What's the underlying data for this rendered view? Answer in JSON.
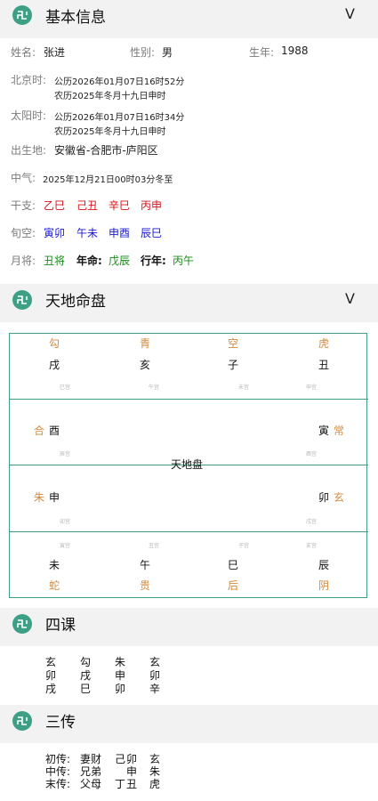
{
  "basic": {
    "title": "基本信息",
    "chevron": "V",
    "name_label": "姓名:",
    "name": "张进",
    "gender_label": "性别:",
    "gender": "男",
    "year_label": "生年:",
    "year": "1988",
    "beijing_label": "北京时:",
    "beijing_line1": "公历2026年01月07日16时52分",
    "beijing_line2": "农历2025年冬月十九日申时",
    "solar_label": "太阳时:",
    "solar_line1": "公历2026年01月07日16时34分",
    "solar_line2": "农历2025年冬月十九日申时",
    "birthplace_label": "出生地:",
    "birthplace": "安徽省-合肥市-庐阳区",
    "zhongqi_label": "中气:",
    "zhongqi": "2025年12月21日00时03分冬至",
    "ganzhi_label": "干支:",
    "ganzhi": [
      "乙巳",
      "己丑",
      "辛巳",
      "丙申"
    ],
    "xunkong_label": "旬空:",
    "xunkong": [
      "寅卯",
      "午未",
      "申酉",
      "辰巳"
    ],
    "yuejiang_label": "月将:",
    "yuejiang": "丑将",
    "nianming_label": "年命:",
    "nianming": "戊辰",
    "xingnian_label": "行年:",
    "xingnian": "丙午"
  },
  "tiandi": {
    "title": "天地命盘",
    "chevron": "V",
    "center_label": "天地盘",
    "top": {
      "generals": [
        "勾",
        "青",
        "空",
        "虎"
      ],
      "branches": [
        "戌",
        "亥",
        "子",
        "丑"
      ],
      "gongs": [
        "巳宫",
        "午宫",
        "未宫",
        "申宫"
      ]
    },
    "left_upper": {
      "general": "合",
      "branch": "酉",
      "gong": "辰宫"
    },
    "right_upper": {
      "general": "常",
      "branch": "寅",
      "gong": "酉宫"
    },
    "left_lower": {
      "general": "朱",
      "branch": "申",
      "gong": "卯宫"
    },
    "right_lower": {
      "general": "玄",
      "branch": "卯",
      "gong": "戌宫"
    },
    "bottom": {
      "gongs": [
        "寅宫",
        "丑宫",
        "子宫",
        "亥宫"
      ],
      "branches": [
        "未",
        "午",
        "巳",
        "辰"
      ],
      "generals": [
        "蛇",
        "贵",
        "后",
        "阴"
      ]
    }
  },
  "sike": {
    "title": "四课",
    "rows": [
      [
        "玄",
        "勾",
        "朱",
        "玄"
      ],
      [
        "卯",
        "戌",
        "申",
        "卯"
      ],
      [
        "戌",
        "巳",
        "卯",
        "辛"
      ]
    ]
  },
  "sanchuan": {
    "title": "三传",
    "rows": [
      {
        "label": "初传:",
        "liuqin": "妻财",
        "dunggan": "己",
        "branch": "卯",
        "general": "玄"
      },
      {
        "label": "中传:",
        "liuqin": "兄弟",
        "dunggan": "",
        "branch": "申",
        "general": "朱"
      },
      {
        "label": "末传:",
        "liuqin": "父母",
        "dunggan": "丁",
        "branch": "丑",
        "general": "虎"
      }
    ]
  },
  "icons": {
    "section_logo": "swastika-emblem-icon",
    "collapse": "chevron-down-icon"
  },
  "colors": {
    "accent": "#3e9f87",
    "general_text": "#d28a40",
    "ganzhi": "#d6131b",
    "xunkong": "#1a1ad0",
    "green": "#1a8a1a"
  }
}
